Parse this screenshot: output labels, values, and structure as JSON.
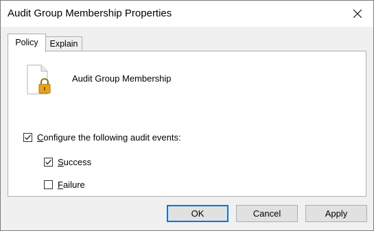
{
  "window": {
    "title": "Audit Group Membership Properties"
  },
  "tabs": [
    {
      "label": "Policy",
      "selected": true
    },
    {
      "label": "Explain",
      "selected": false
    }
  ],
  "policy": {
    "name": "Audit Group Membership",
    "icon": "document-lock-icon"
  },
  "options": {
    "configure": {
      "label_accel": "C",
      "label_rest": "onfigure the following audit events:",
      "checked": true
    },
    "success": {
      "label_accel": "S",
      "label_rest": "uccess",
      "checked": true
    },
    "failure": {
      "label_accel": "F",
      "label_rest": "ailure",
      "checked": false
    }
  },
  "buttons": {
    "ok": "OK",
    "cancel": "Cancel",
    "apply": "Apply"
  },
  "colors": {
    "accent": "#0078d7",
    "lock": "#e8a317"
  }
}
